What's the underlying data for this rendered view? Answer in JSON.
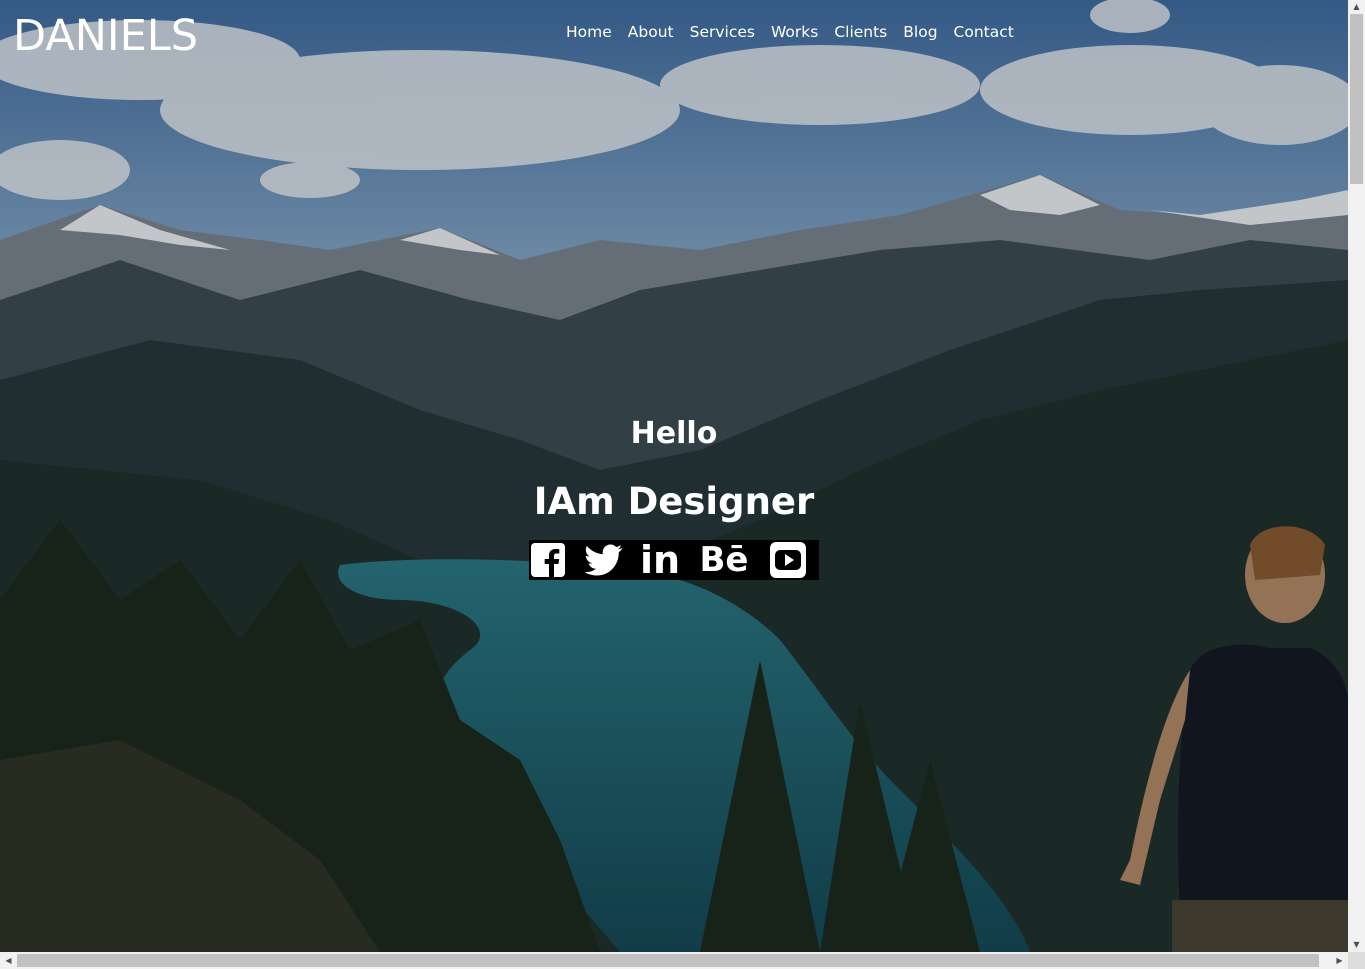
{
  "brand": {
    "logo_text": "DANIELS"
  },
  "nav": {
    "items": [
      {
        "label": "Home"
      },
      {
        "label": "About"
      },
      {
        "label": "Services"
      },
      {
        "label": "Works"
      },
      {
        "label": "Clients"
      },
      {
        "label": "Blog"
      },
      {
        "label": "Contact"
      }
    ]
  },
  "hero": {
    "greeting": "Hello",
    "headline": "IAm Designer",
    "social": [
      {
        "icon": "facebook-icon"
      },
      {
        "icon": "twitter-icon"
      },
      {
        "icon": "linkedin-icon",
        "text": "in"
      },
      {
        "icon": "behance-icon",
        "text": "Bē"
      },
      {
        "icon": "youtube-icon"
      }
    ]
  },
  "colors": {
    "text": "#ffffff",
    "social_bar_bg": "#000000"
  }
}
